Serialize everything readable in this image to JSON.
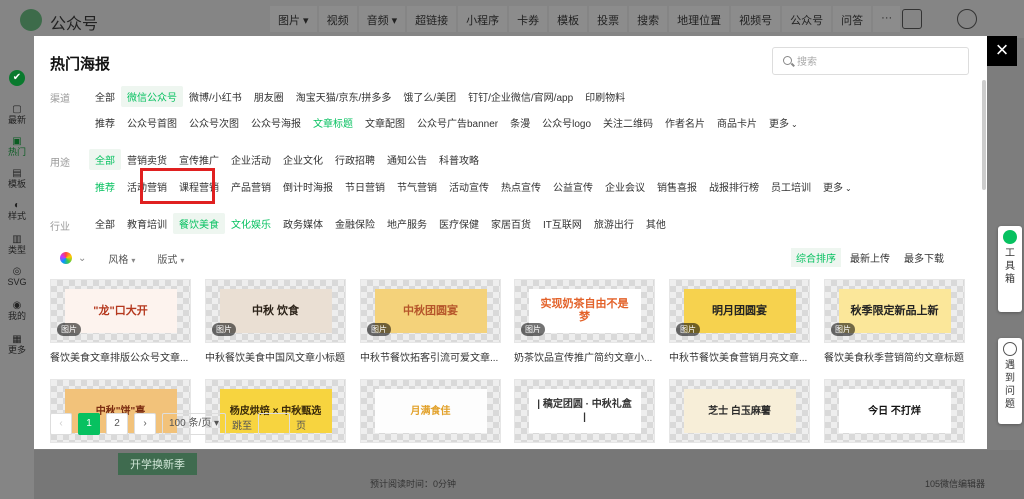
{
  "app": {
    "brand": "公众号",
    "toolbar": [
      "图片 ▾",
      "视频",
      "音频 ▾",
      "超链接",
      "小程序",
      "卡券",
      "模板",
      "投票",
      "搜索",
      "地理位置",
      "视频号",
      "公众号",
      "问答",
      "···"
    ],
    "sidebar": [
      {
        "label": "",
        "glyph": "✔"
      },
      {
        "label": "最新",
        "glyph": "▢"
      },
      {
        "label": "热门",
        "glyph": "▣"
      },
      {
        "label": "模板",
        "glyph": "▤"
      },
      {
        "label": "样式",
        "glyph": "◐"
      },
      {
        "label": "类型",
        "glyph": "▥"
      },
      {
        "label": "SVG",
        "glyph": "◎"
      },
      {
        "label": "我的",
        "glyph": "◉"
      },
      {
        "label": "更多",
        "glyph": "▦"
      }
    ],
    "bottom": {
      "button": "开学换新季",
      "read_time": "预计阅读时间：0分钟",
      "brand_hint": "105微信编辑器"
    }
  },
  "float_tools": {
    "toolbox": "工具箱",
    "help": "遇到问题"
  },
  "modal": {
    "title": "热门海报",
    "close": "×",
    "search_placeholder": "搜索",
    "channel": {
      "label": "渠道",
      "row1": [
        "全部",
        "微信公众号",
        "微博/小红书",
        "朋友圈",
        "淘宝天猫/京东/拼多多",
        "饿了么/美团",
        "钉钉/企业微信/官网/app",
        "印刷物料"
      ],
      "row2": [
        "推荐",
        "公众号首图",
        "公众号次图",
        "公众号海报",
        "文章标题",
        "文章配图",
        "公众号广告banner",
        "条漫",
        "公众号logo",
        "关注二维码",
        "作者名片",
        "商品卡片",
        "更多"
      ]
    },
    "usage": {
      "label": "用途",
      "row1": [
        "全部",
        "营销卖货",
        "宣传推广",
        "企业活动",
        "企业文化",
        "行政招聘",
        "通知公告",
        "科普攻略"
      ],
      "row2": [
        "推荐",
        "活动营销",
        "课程营销",
        "产品营销",
        "倒计时海报",
        "节日营销",
        "节气营销",
        "活动宣传",
        "热点宣传",
        "公益宣传",
        "企业会议",
        "销售喜报",
        "战报排行榜",
        "员工培训",
        "更多"
      ]
    },
    "industry": {
      "label": "行业",
      "row1": [
        "全部",
        "教育培训",
        "餐饮美食",
        "文化娱乐",
        "政务媒体",
        "金融保险",
        "地产服务",
        "医疗保健",
        "家居百货",
        "IT互联网",
        "旅游出行",
        "其他"
      ]
    },
    "filters": {
      "style": "风格",
      "layout": "版式"
    },
    "sorts": [
      "综合排序",
      "最新上传",
      "最多下载"
    ],
    "badge": "图片",
    "cards": [
      {
        "title": "餐饮美食文章排版公众号文章...",
        "art": "\"龙\"口大开",
        "bg": "#fdf3ee",
        "color": "#b5381e"
      },
      {
        "title": "中秋餐饮美食中国风文章小标题",
        "art": "中秋 饮食",
        "bg": "#eadfd3",
        "color": "#2b2218"
      },
      {
        "title": "中秋节餐饮拓客引流可爱文章...",
        "art": "中秋团圆宴",
        "bg": "#f4d27a",
        "color": "#b5552a"
      },
      {
        "title": "奶茶饮品宣传推广简约文章小...",
        "art": "实现奶茶自由不是梦",
        "bg": "#ffffff",
        "color": "#e3622a"
      },
      {
        "title": "中秋节餐饮美食营销月亮文章...",
        "art": "明月团圆宴",
        "bg": "#f6d24e",
        "color": "#222222"
      },
      {
        "title": "餐饮美食秋季营销简约文章标题",
        "art": "秋季限定新品上新",
        "bg": "#fbe79a",
        "color": "#222222"
      },
      {
        "title": "",
        "art": "中秋\"饼\"喜",
        "bg": "#f2c27a",
        "color": "#7a2b10"
      },
      {
        "title": "",
        "art": "杨皮烘焙 × 中秋甄选",
        "bg": "#f7d43f",
        "color": "#3a2a0a"
      },
      {
        "title": "",
        "art": "月满食佳",
        "bg": "#fdfdfd",
        "color": "#e2a12a"
      },
      {
        "title": "",
        "art": "| 稿定团圆 · 中秋礼盒 |",
        "bg": "#ffffff",
        "color": "#333333"
      },
      {
        "title": "",
        "art": "芝士 白玉麻薯",
        "bg": "#f7eed8",
        "color": "#2b2b2b"
      },
      {
        "title": "",
        "art": "今日 不打烊",
        "bg": "#ffffff",
        "color": "#111111"
      }
    ],
    "pagination": {
      "prev": "‹",
      "pages": [
        "1",
        "2"
      ],
      "next": "›",
      "page_size": "100 条/页 ▾",
      "jump_label": "跳至",
      "page_unit": "页"
    }
  },
  "colors": {
    "accent": "#07c160",
    "highlight": "#e02020"
  }
}
